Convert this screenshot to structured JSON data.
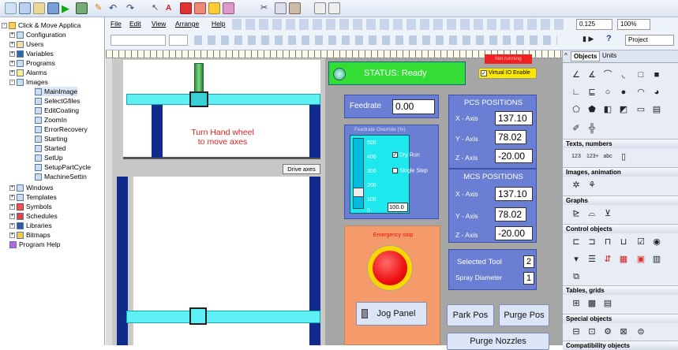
{
  "menu": {
    "file": "File",
    "edit": "Edit",
    "view": "View",
    "arrange": "Arrange",
    "help": "Help"
  },
  "toolbar": {
    "zoom": "0.125",
    "zoom_pct": "100%",
    "project": "Project"
  },
  "tree": {
    "root": "Click & Move Applica",
    "configuration": "Configuration",
    "users": "Users",
    "variables": "Variables",
    "programs": "Programs",
    "alarms": "Alarms",
    "images": "Images",
    "images_children": [
      "MainImage",
      "SelectGfiles",
      "EditCoating",
      "ZoomIn",
      "ErrorRecovery",
      "Starting",
      "Started",
      "SetUp",
      "SetupPartCycle",
      "MachineSettin"
    ],
    "windows": "Windows",
    "templates": "Templates",
    "symbols": "Symbols",
    "schedules": "Schedules",
    "libraries": "Libraries",
    "bitmaps": "Bitmaps",
    "program_help": "Program Help"
  },
  "canvas": {
    "handwheel_line1": "Turn Hand wheel",
    "handwheel_line2": "to move axes",
    "drive_axes": "Drive axes"
  },
  "status": {
    "text": "STATUS: Ready",
    "notice_label": "Not running",
    "virtual_io": "Virtual IO Enable"
  },
  "feedrate": {
    "label": "Feedrate",
    "value": "0.00"
  },
  "override": {
    "title": "Feedrate Override (%)",
    "ticks": [
      "500",
      "400",
      "300",
      "200",
      "100",
      "0"
    ],
    "value": "100.0",
    "dry_run": "Dry Run",
    "single_step": "Single Step"
  },
  "emergency": {
    "label": "Emergency stop"
  },
  "jog": {
    "label": "Jog Panel"
  },
  "pcs": {
    "title": "PCS POSITIONS",
    "x_label": "X - Axis",
    "x": "137.10",
    "y_label": "Y - Axis",
    "y": "78.02",
    "z_label": "Z - Axis",
    "z": "-20.00"
  },
  "mcs": {
    "title": "MCS POSITIONS",
    "x_label": "X - Axis",
    "x": "137.10",
    "y_label": "Y - Axis",
    "y": "78.02",
    "z_label": "Z - Axis",
    "z": "-20.00"
  },
  "tool": {
    "selected_label": "Selected Tool",
    "selected": "2",
    "spray_label": "Spray Diameter",
    "spray": "1"
  },
  "buttons": {
    "park": "Park Pos",
    "purge": "Purge Pos",
    "purge_nozzles": "Purge Nozzles"
  },
  "objects": {
    "tab_objects": "Objects",
    "tab_units": "Units",
    "sections": [
      "Texts, numbers",
      "Images, animation",
      "Graphs",
      "Control objects",
      "Tables, grids",
      "Special objects",
      "Compatibility objects"
    ]
  },
  "colors": {
    "status_green": "#33dd33",
    "panel_blue": "#6a7fd3",
    "cyan_bar": "#5ff0f5",
    "orange_panel": "#f59a6a",
    "estop_red": "#ee1111"
  }
}
